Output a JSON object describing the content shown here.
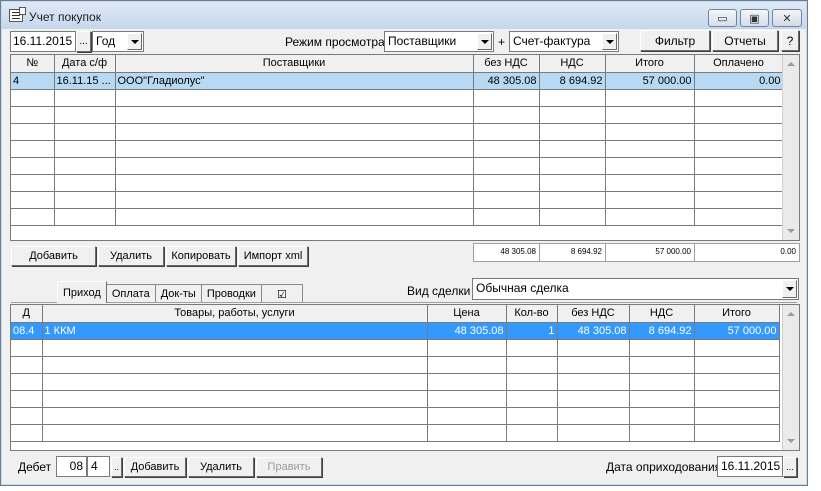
{
  "window": {
    "title": "Учет покупок",
    "buttons": {
      "minimize": "▭",
      "maximize": "▣",
      "close": "✕"
    }
  },
  "toolbar": {
    "date": "16.11.2015",
    "date_picker": "...",
    "period": "Год",
    "view_mode_label": "Режим просмотра:",
    "view_mode": "Поставщики",
    "plus": "+",
    "doc_type": "Счет-фактура",
    "filter_label": "Фильтр",
    "reports_label": "Отчеты",
    "help_label": "?"
  },
  "top_grid": {
    "headers": [
      "№",
      "Дата с/ф",
      "Поставщики",
      "без НДС",
      "НДС",
      "Итого",
      "Оплачено"
    ],
    "rows": [
      [
        "4",
        "16.11.15 ...",
        "ООО\"Гладиолус\"",
        "48 305.08",
        "8 694.92",
        "57 000.00",
        "0.00"
      ]
    ],
    "totals": [
      "48 305.08",
      "8 694.92",
      "57 000.00",
      "0.00"
    ]
  },
  "top_actions": {
    "add": "Добавить",
    "delete": "Удалить",
    "copy": "Копировать",
    "import": "Импорт xml"
  },
  "tabs": [
    "Приход",
    "Оплата",
    "Док-ты",
    "Проводки",
    "☑"
  ],
  "deal": {
    "label": "Вид сделки",
    "value": "Обычная сделка"
  },
  "bottom_grid": {
    "headers": [
      "Д",
      "Товары, работы, услуги",
      "Цена",
      "Кол-во",
      "без НДС",
      "НДС",
      "Итого"
    ],
    "rows": [
      [
        "08.4",
        "1 ККМ",
        "48 305.08",
        "1",
        "48 305.08",
        "8 694.92",
        "57 000.00"
      ]
    ]
  },
  "bottom_actions": {
    "debit_label": "Дебет",
    "debit_account": "08",
    "debit_sub": "4",
    "debit_picker": "..",
    "add": "Добавить",
    "delete": "Удалить",
    "edit": "Править",
    "posting_date_label": "Дата оприходования",
    "posting_date": "16.11.2015",
    "posting_date_picker": "..."
  },
  "colors": {
    "selected_row_light": "#b7d9f3",
    "selected_row_dark": "#3399ff"
  }
}
